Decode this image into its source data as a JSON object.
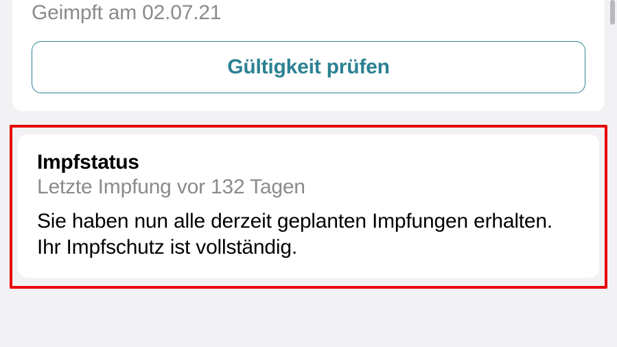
{
  "certificate": {
    "vaccinated_on_label": "Geimpft am 02.07.21",
    "verify_button_label": "Gültigkeit prüfen"
  },
  "status": {
    "title": "Impfstatus",
    "subtitle": "Letzte Impfung vor 132 Tagen",
    "body": "Sie haben nun alle derzeit geplanten Impfungen erhalten. Ihr Impfschutz ist vollständig."
  }
}
